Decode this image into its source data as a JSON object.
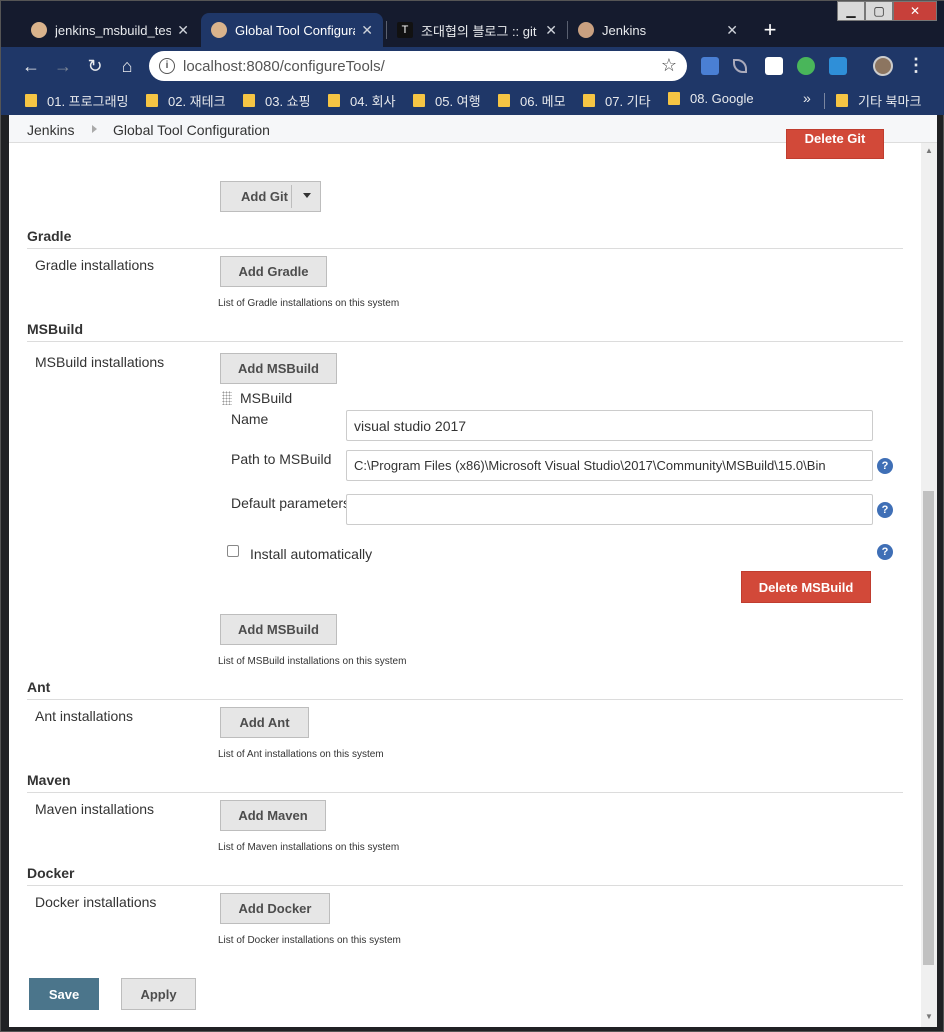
{
  "tabs": [
    {
      "title": "jenkins_msbuild_test (",
      "active": false
    },
    {
      "title": "Global Tool Configura",
      "active": true
    },
    {
      "title": "조대협의 블로그 :: git",
      "active": false
    },
    {
      "title": "Jenkins",
      "active": false
    }
  ],
  "toolbar": {
    "url": "localhost:8080/configureTools/"
  },
  "bookmarks": [
    "01. 프로그래밍",
    "02. 재테크",
    "03. 쇼핑",
    "04. 회사",
    "05. 여행",
    "06. 메모",
    "07. 기타",
    "08. Google"
  ],
  "other_bookmarks": "기타 북마크",
  "breadcrumb": {
    "root": "Jenkins",
    "current": "Global Tool Configuration"
  },
  "git": {
    "delete_label": "Delete Git",
    "add_label": "Add Git"
  },
  "gradle": {
    "title": "Gradle",
    "installations_label": "Gradle installations",
    "add_label": "Add Gradle",
    "hint": "List of Gradle installations on this system"
  },
  "msbuild": {
    "title": "MSBuild",
    "installations_label": "MSBuild installations",
    "add_label": "Add MSBuild",
    "item_title": "MSBuild",
    "name_label": "Name",
    "name_value": "visual studio 2017",
    "path_label": "Path to MSBuild",
    "path_value": "C:\\Program Files (x86)\\Microsoft Visual Studio\\2017\\Community\\MSBuild\\15.0\\Bin",
    "params_label": "Default parameters",
    "params_value": "",
    "install_auto_label": "Install automatically",
    "delete_label": "Delete MSBuild",
    "add_label_2": "Add MSBuild",
    "hint": "List of MSBuild installations on this system"
  },
  "ant": {
    "title": "Ant",
    "installations_label": "Ant installations",
    "add_label": "Add Ant",
    "hint": "List of Ant installations on this system"
  },
  "maven": {
    "title": "Maven",
    "installations_label": "Maven installations",
    "add_label": "Add Maven",
    "hint": "List of Maven installations on this system"
  },
  "docker": {
    "title": "Docker",
    "installations_label": "Docker installations",
    "add_label": "Add Docker",
    "hint": "List of Docker installations on this system"
  },
  "actions": {
    "save_label": "Save",
    "apply_label": "Apply"
  },
  "help_glyph": "?",
  "colors": {
    "chrome_frame": "#151b2e",
    "chrome_toolbar": "#1f3768",
    "delete_red": "#d24939",
    "save_blue": "#4b758b",
    "help_blue": "#3f6fb6"
  }
}
